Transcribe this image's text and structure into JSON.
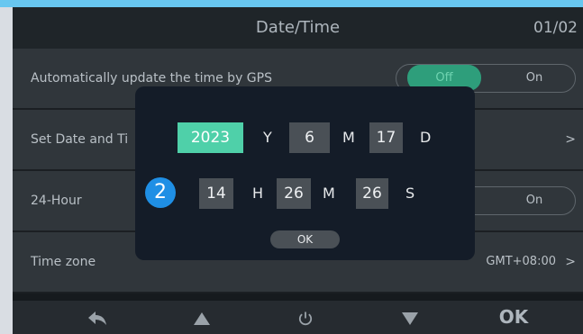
{
  "header": {
    "title": "Date/Time",
    "page": "01/02"
  },
  "settings": {
    "auto_gps": {
      "label": "Automatically update the time by GPS",
      "toggle_off": "Off",
      "toggle_on": "On",
      "selected": "Off"
    },
    "set_date": {
      "label": "Set Date and Ti"
    },
    "hour24": {
      "label": "24-Hour",
      "toggle_on": "On"
    },
    "timezone": {
      "label": "Time zone",
      "value": "GMT+08:00"
    }
  },
  "dialog": {
    "year": "2023",
    "year_unit": "Y",
    "month": "6",
    "month_unit": "M",
    "day": "17",
    "day_unit": "D",
    "hour": "14",
    "hour_unit": "H",
    "minute": "26",
    "minute_unit": "M",
    "second": "26",
    "second_unit": "S",
    "ok": "OK",
    "callout_number": "2"
  },
  "footer": {
    "ok": "OK"
  },
  "icons": [
    "back-arrow-icon",
    "up-triangle-icon",
    "power-icon",
    "down-triangle-icon"
  ],
  "colors": {
    "accent": "#4fd0a9",
    "callout": "#1f8fe5",
    "top_bar": "#68c7f0"
  }
}
